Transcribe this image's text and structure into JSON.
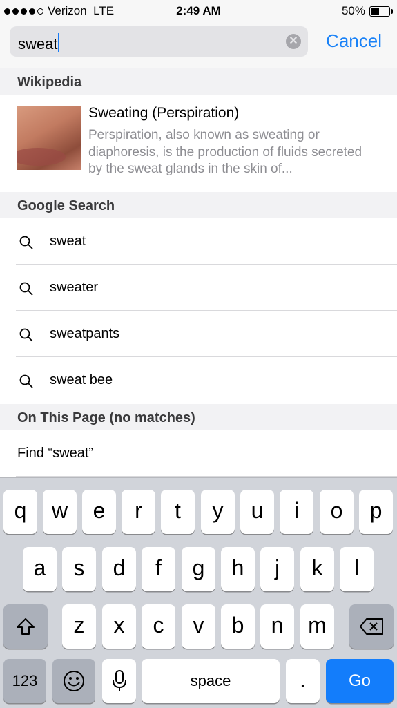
{
  "status_bar": {
    "carrier": "Verizon",
    "network": "LTE",
    "time": "2:49 AM",
    "battery": "50%",
    "battery_level": 0.5
  },
  "search": {
    "query": "sweat",
    "cancel_label": "Cancel"
  },
  "wikipedia": {
    "section_title": "Wikipedia",
    "title": "Sweating (Perspiration)",
    "description": "Perspiration, also known as sweating or diaphoresis, is the production of fluids secreted by the sweat glands in the skin of..."
  },
  "google": {
    "section_title": "Google Search",
    "suggestions": [
      "sweat",
      "sweater",
      "sweatpants",
      "sweat bee"
    ]
  },
  "on_page": {
    "section_title": "On This Page (no matches)",
    "find_label": "Find “sweat”"
  },
  "keyboard": {
    "row1": [
      "q",
      "w",
      "e",
      "r",
      "t",
      "y",
      "u",
      "i",
      "o",
      "p"
    ],
    "row2": [
      "a",
      "s",
      "d",
      "f",
      "g",
      "h",
      "j",
      "k",
      "l"
    ],
    "row3": [
      "z",
      "x",
      "c",
      "v",
      "b",
      "n",
      "m"
    ],
    "numbers_label": "123",
    "space_label": "space",
    "period_label": ".",
    "go_label": "Go",
    "icons": {
      "shift": "shift-icon",
      "delete": "delete-icon",
      "emoji": "emoji-icon",
      "mic": "microphone-icon"
    }
  }
}
